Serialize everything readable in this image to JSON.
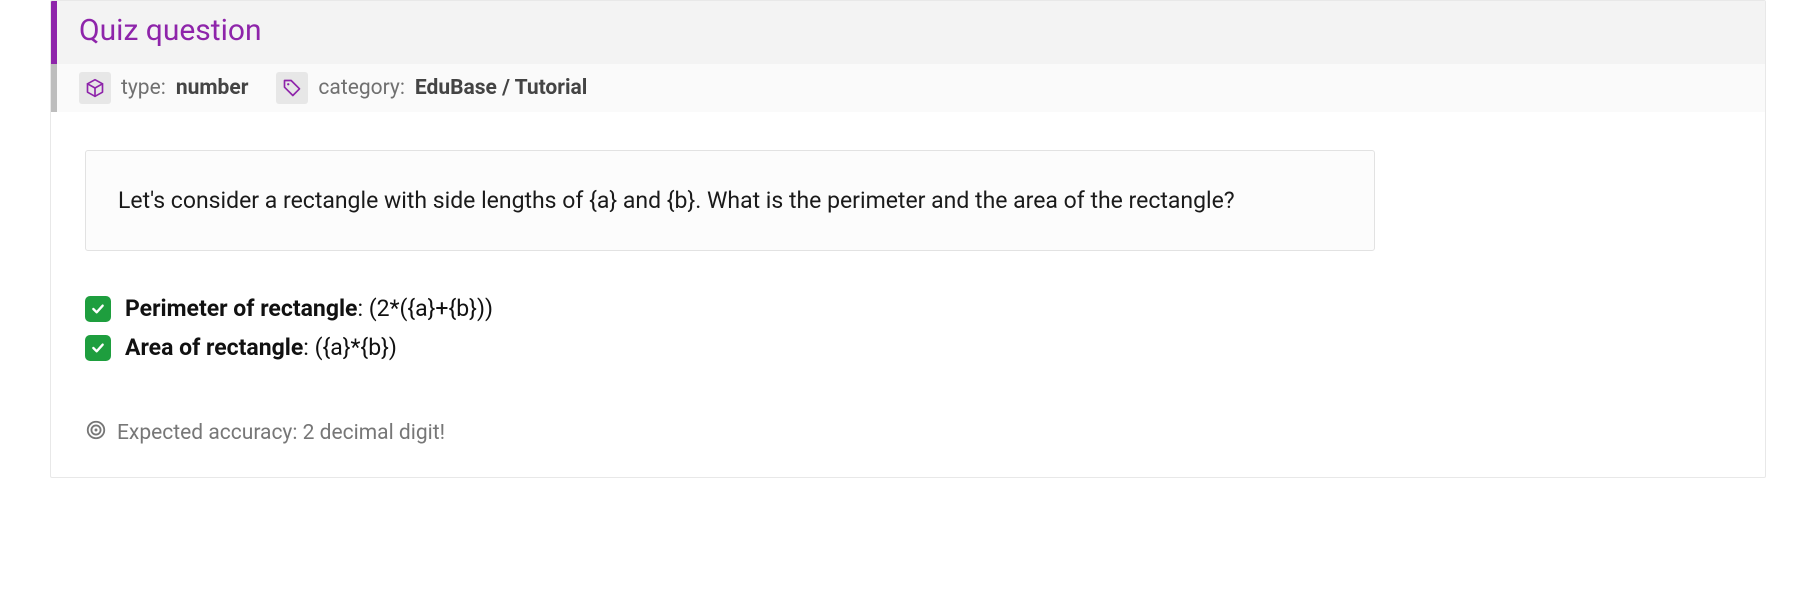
{
  "header": {
    "title": "Quiz question"
  },
  "meta": {
    "type_label": "type:",
    "type_value": "number",
    "category_label": "category:",
    "category_value": "EduBase / Tutorial"
  },
  "question": {
    "text": "Let's consider a rectangle with side lengths of {a} and {b}. What is the perimeter and the area of the rectangle?"
  },
  "answers": [
    {
      "label": "Perimeter of rectangle",
      "value": "(2*({a}+{b}))"
    },
    {
      "label": "Area of rectangle",
      "value": "({a}*{b})"
    }
  ],
  "accuracy": {
    "text": "Expected accuracy: 2 decimal digit!"
  }
}
